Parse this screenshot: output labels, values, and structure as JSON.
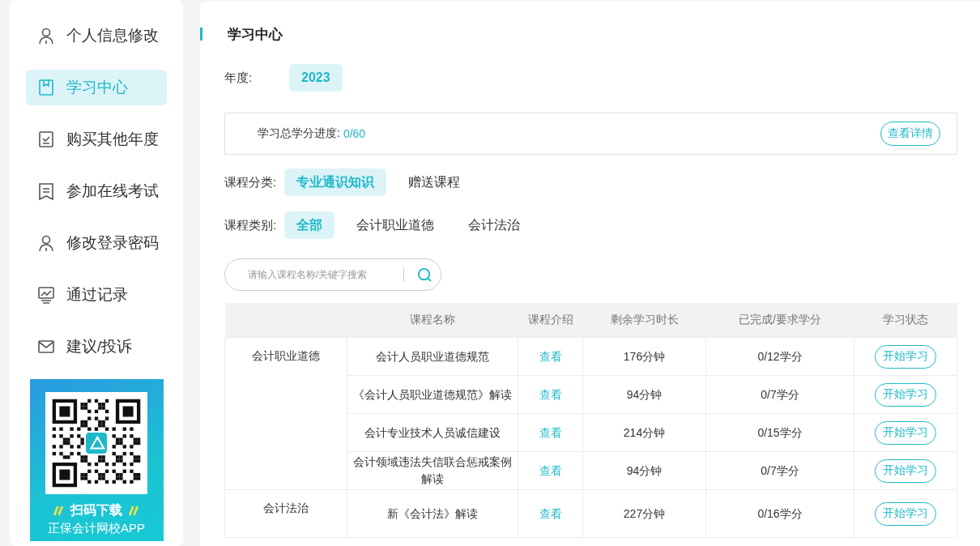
{
  "sidebar": {
    "items": [
      {
        "label": "个人信息修改",
        "kind": "person",
        "selected": false
      },
      {
        "label": "学习中心",
        "kind": "book",
        "selected": true
      },
      {
        "label": "购买其他年度",
        "kind": "check",
        "selected": false
      },
      {
        "label": "参加在线考试",
        "kind": "note",
        "selected": false
      },
      {
        "label": "修改登录密码",
        "kind": "person",
        "selected": false
      },
      {
        "label": "通过记录",
        "kind": "chart",
        "selected": false
      },
      {
        "label": "建议/投诉",
        "kind": "mail",
        "selected": false
      }
    ],
    "banner": {
      "title": "扫码下载",
      "subtitle": "正保会计网校APP"
    }
  },
  "main": {
    "title": "学习中心",
    "year": {
      "label": "年度:",
      "options": [
        {
          "label": "2023",
          "selected": true
        }
      ]
    },
    "progress": {
      "label": "学习总学分进度:",
      "value": "0/60",
      "button": "查看详情"
    },
    "filters": [
      {
        "label": "课程分类:",
        "options": [
          {
            "label": "专业通识知识",
            "selected": true
          },
          {
            "label": "赠送课程",
            "selected": false
          }
        ]
      },
      {
        "label": "课程类别:",
        "options": [
          {
            "label": "全部",
            "selected": true
          },
          {
            "label": "会计职业道德",
            "selected": false
          },
          {
            "label": "会计法治",
            "selected": false
          }
        ]
      }
    ],
    "search": {
      "placeholder": "请输入课程名称/关键字搜索"
    },
    "table": {
      "columns": [
        "",
        "课程名称",
        "课程介绍",
        "剩余学习时长",
        "已完成/要求学分",
        "学习状态"
      ],
      "groups": [
        {
          "category": "会计职业道德",
          "rows": [
            {
              "name": "会计人员职业道德规范",
              "intro": "查看",
              "remaining": "176分钟",
              "credits": "0/12学分",
              "action": "开始学习"
            },
            {
              "name": "《会计人员职业道德规范》解读",
              "intro": "查看",
              "remaining": "94分钟",
              "credits": "0/7学分",
              "action": "开始学习"
            },
            {
              "name": "会计专业技术人员诚信建设",
              "intro": "查看",
              "remaining": "214分钟",
              "credits": "0/15学分",
              "action": "开始学习"
            },
            {
              "name": "会计领域违法失信联合惩戒案例解读",
              "intro": "查看",
              "remaining": "94分钟",
              "credits": "0/7学分",
              "action": "开始学习"
            }
          ]
        },
        {
          "category": "会计法治",
          "rows": [
            {
              "name": "新《会计法》解读",
              "intro": "查看",
              "remaining": "227分钟",
              "credits": "0/16学分",
              "action": "开始学习"
            }
          ]
        }
      ]
    }
  }
}
